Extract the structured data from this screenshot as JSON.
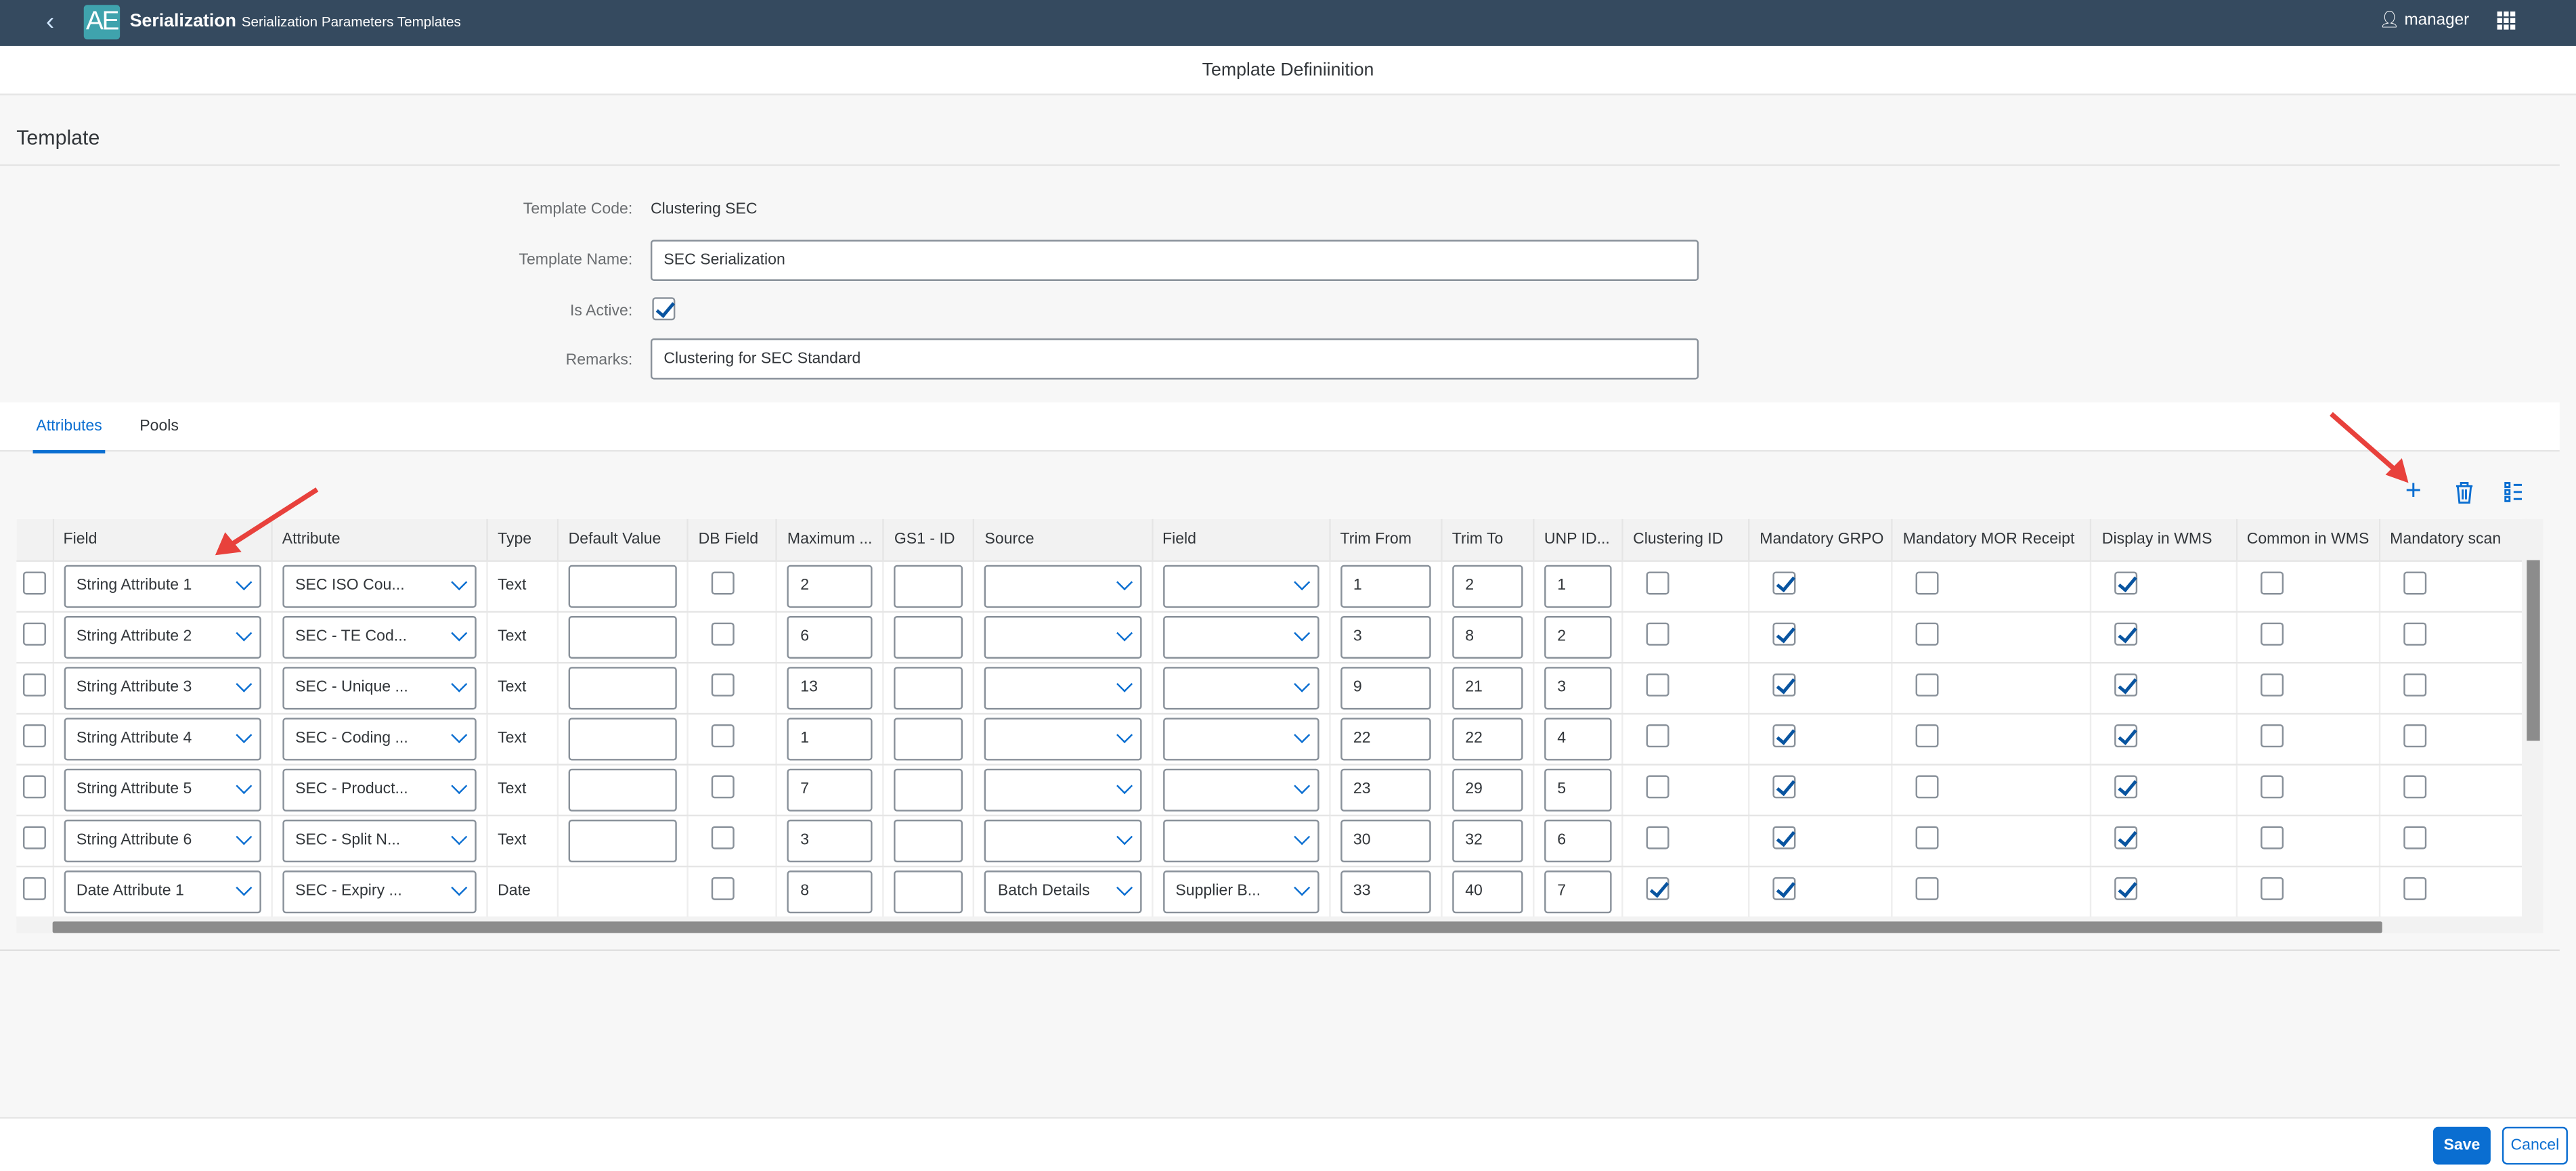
{
  "header": {
    "app_name": "Serialization",
    "logo_text": "AE",
    "subtitle": "Serialization Parameters Templates",
    "user": "manager"
  },
  "subheader": {
    "title": "Template Definiinition"
  },
  "section": {
    "title": "Template"
  },
  "form": {
    "template_code_label": "Template Code:",
    "template_code": "Clustering SEC",
    "template_name_label": "Template Name:",
    "template_name": "SEC Serialization",
    "is_active_label": "Is Active:",
    "is_active": true,
    "remarks_label": "Remarks:",
    "remarks": "Clustering for SEC Standard"
  },
  "tabs": [
    {
      "label": "Attributes",
      "active": true
    },
    {
      "label": "Pools",
      "active": false
    }
  ],
  "toolbar": {
    "icons": [
      "add-icon",
      "delete-icon",
      "column-settings-icon"
    ]
  },
  "table": {
    "columns": [
      "",
      "Field",
      "Attribute",
      "Type",
      "Default Value",
      "DB Field",
      "Maximum ...",
      "GS1 - ID",
      "Source",
      "Field",
      "Trim From",
      "Trim To",
      "UNP ID...",
      "Clustering ID",
      "Mandatory GRPO",
      "Mandatory MOR Receipt",
      "Display in WMS",
      "Common in WMS",
      "Mandatory scan"
    ],
    "rows": [
      {
        "field": "String Attribute 1",
        "attribute": "SEC ISO Cou...",
        "type": "Text",
        "default": "",
        "db": false,
        "max": "2",
        "gs1": "",
        "source": "",
        "field2": "",
        "trim_from": "1",
        "trim_to": "2",
        "unp": "1",
        "cluster": false,
        "grpo": true,
        "mor": false,
        "display": true,
        "common": false,
        "scan": false
      },
      {
        "field": "String Attribute 2",
        "attribute": "SEC - TE Cod...",
        "type": "Text",
        "default": "",
        "db": false,
        "max": "6",
        "gs1": "",
        "source": "",
        "field2": "",
        "trim_from": "3",
        "trim_to": "8",
        "unp": "2",
        "cluster": false,
        "grpo": true,
        "mor": false,
        "display": true,
        "common": false,
        "scan": false
      },
      {
        "field": "String Attribute 3",
        "attribute": "SEC - Unique ...",
        "type": "Text",
        "default": "",
        "db": false,
        "max": "13",
        "gs1": "",
        "source": "",
        "field2": "",
        "trim_from": "9",
        "trim_to": "21",
        "unp": "3",
        "cluster": false,
        "grpo": true,
        "mor": false,
        "display": true,
        "common": false,
        "scan": false
      },
      {
        "field": "String Attribute 4",
        "attribute": "SEC - Coding ...",
        "type": "Text",
        "default": "",
        "db": false,
        "max": "1",
        "gs1": "",
        "source": "",
        "field2": "",
        "trim_from": "22",
        "trim_to": "22",
        "unp": "4",
        "cluster": false,
        "grpo": true,
        "mor": false,
        "display": true,
        "common": false,
        "scan": false
      },
      {
        "field": "String Attribute 5",
        "attribute": "SEC - Product...",
        "type": "Text",
        "default": "",
        "db": false,
        "max": "7",
        "gs1": "",
        "source": "",
        "field2": "",
        "trim_from": "23",
        "trim_to": "29",
        "unp": "5",
        "cluster": false,
        "grpo": true,
        "mor": false,
        "display": true,
        "common": false,
        "scan": false
      },
      {
        "field": "String Attribute 6",
        "attribute": "SEC - Split N...",
        "type": "Text",
        "default": "",
        "db": false,
        "max": "3",
        "gs1": "",
        "source": "",
        "field2": "",
        "trim_from": "30",
        "trim_to": "32",
        "unp": "6",
        "cluster": false,
        "grpo": true,
        "mor": false,
        "display": true,
        "common": false,
        "scan": false
      },
      {
        "field": "Date Attribute 1",
        "attribute": "SEC - Expiry ...",
        "type": "Date",
        "default": null,
        "db": false,
        "max": "8",
        "gs1": "",
        "source": "Batch Details",
        "field2": "Supplier B...",
        "trim_from": "33",
        "trim_to": "40",
        "unp": "7",
        "cluster": true,
        "grpo": true,
        "mor": false,
        "display": true,
        "common": false,
        "scan": false
      }
    ]
  },
  "footer": {
    "save_label": "Save",
    "cancel_label": "Cancel"
  },
  "colors": {
    "shell": "#354a5f",
    "logo": "#3fa3ad",
    "accent": "#0a6ed1",
    "annotation_arrow": "#e8413c"
  }
}
